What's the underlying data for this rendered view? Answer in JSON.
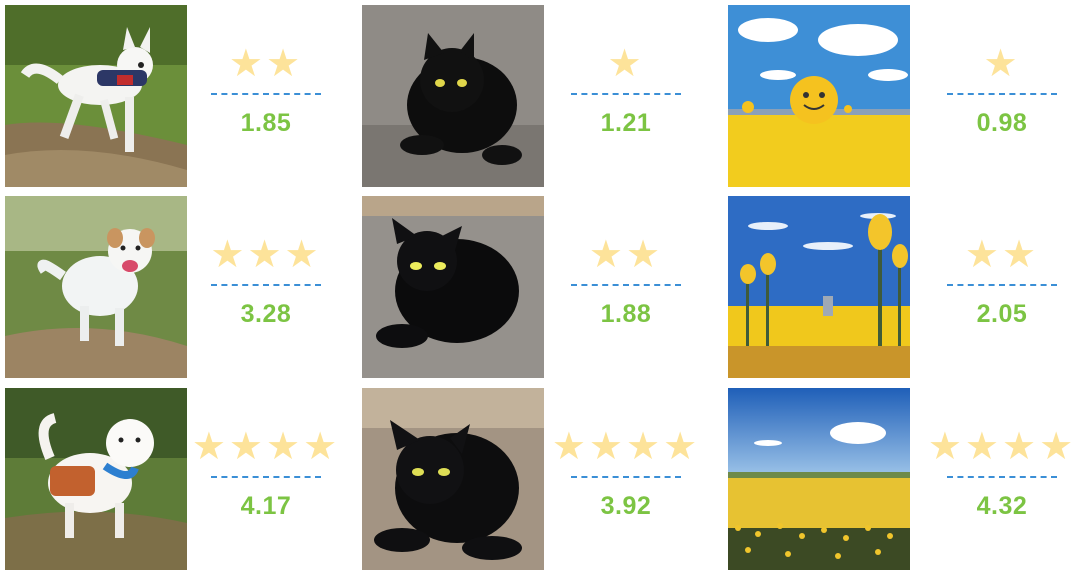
{
  "rows": [
    {
      "cells": [
        {
          "subject": "dog",
          "icon": "dog-photo",
          "stars": 2,
          "score": "1.85"
        },
        {
          "subject": "cat",
          "icon": "cat-photo",
          "stars": 1,
          "score": "1.21"
        },
        {
          "subject": "field",
          "icon": "surreal-field-painting",
          "stars": 1,
          "score": "0.98"
        }
      ]
    },
    {
      "cells": [
        {
          "subject": "dog",
          "icon": "dog-photo",
          "stars": 3,
          "score": "3.28"
        },
        {
          "subject": "cat",
          "icon": "cat-photo",
          "stars": 2,
          "score": "1.88"
        },
        {
          "subject": "field",
          "icon": "surreal-field-painting",
          "stars": 2,
          "score": "2.05"
        }
      ]
    },
    {
      "cells": [
        {
          "subject": "dog",
          "icon": "dog-photo",
          "stars": 4,
          "score": "4.17"
        },
        {
          "subject": "cat",
          "icon": "cat-photo",
          "stars": 4,
          "score": "3.92"
        },
        {
          "subject": "field",
          "icon": "field-landscape-painting",
          "stars": 4,
          "score": "4.32"
        }
      ]
    }
  ],
  "colors": {
    "star": "#fde39a",
    "score": "#7cc443",
    "divider": "#3b8fd6"
  }
}
